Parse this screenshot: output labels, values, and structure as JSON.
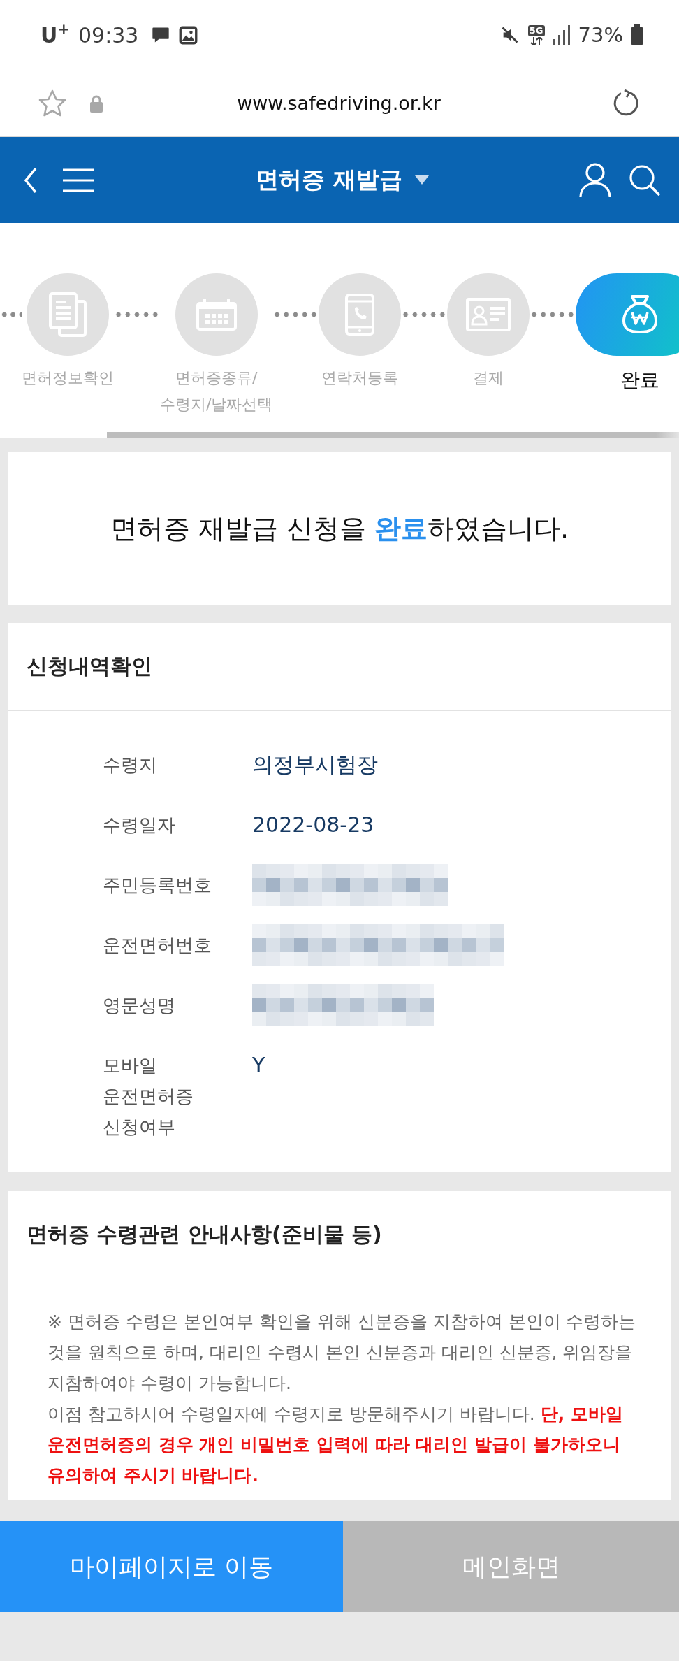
{
  "status_bar": {
    "carrier": "U$^{+}$",
    "time": "09:33",
    "network": "5G",
    "battery": "73%"
  },
  "browser": {
    "url": "www.safedriving.or.kr"
  },
  "header": {
    "title": "면허증 재발급"
  },
  "steps": [
    {
      "label": "면허정보확인",
      "selected": false
    },
    {
      "label": "면허증종류/\n수령지/날짜선택",
      "selected": false
    },
    {
      "label": "연락처등록",
      "selected": false
    },
    {
      "label": "결제",
      "selected": false
    },
    {
      "label": "완료",
      "selected": true
    }
  ],
  "completion": {
    "message": "면허증 재발급 신청을 **완료**하였습니다."
  },
  "details": {
    "title": "신청내역확인",
    "rows": [
      {
        "label": "수령지",
        "kind": "text",
        "value": "의정부시험장"
      },
      {
        "label": "수령일자",
        "kind": "text",
        "value": "2022-08-23"
      },
      {
        "label": "주민등록번호",
        "kind": "pixelated"
      },
      {
        "label": "운전면허번호",
        "kind": "pixelated"
      },
      {
        "label": "영문성명",
        "kind": "pixelated"
      },
      {
        "label": "모바일\n운전면허증\n신청여부",
        "kind": "text",
        "value": "Y"
      }
    ]
  },
  "notice": {
    "title": "면허증 수령관련 안내사항(준비물 등)",
    "text": "※ 면허증 수령은 본인여부 확인을 위해 신분증을 지참하여 본인이 수령하는 것을 원칙으로 하며, 대리인 수령시 본인 신분증과 대리인 신분증, 위임장을 지참하여야 수령이 가능합니다.\n이점 참고하시어 수령일자에 수령지로 방문해주시기 바랍니다. **단, 모바일 운전면허증의 경우 개인 비밀번호 입력에 따라 대리인 발급이 불가하오니 유의하여 주시기 바랍니다.**"
  },
  "buttons": [
    {
      "label": "마이페이지로 이동",
      "kind": "primary"
    },
    {
      "label": "메인화면",
      "kind": "secondary"
    }
  ]
}
